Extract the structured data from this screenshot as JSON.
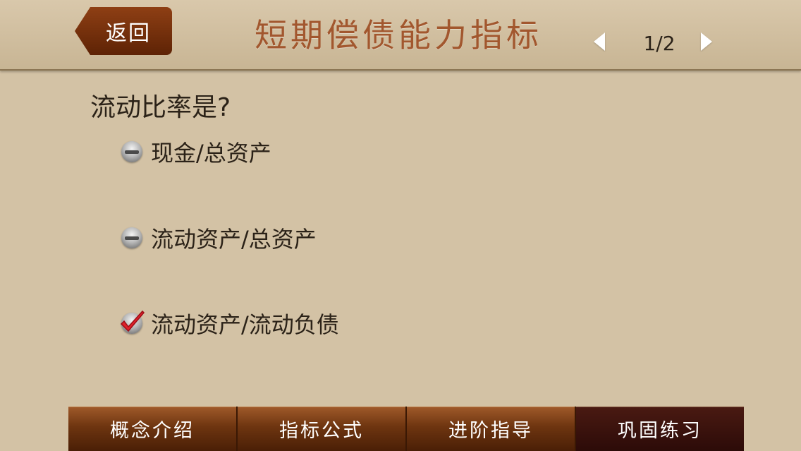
{
  "header": {
    "back_label": "返回",
    "title": "短期偿债能力指标",
    "page_indicator": "1/2"
  },
  "question": {
    "text": "流动比率是?",
    "options": [
      {
        "label": "现金/总资产",
        "selected": false
      },
      {
        "label": "流动资产/总资产",
        "selected": false
      },
      {
        "label": "流动资产/流动负债",
        "selected": true
      }
    ]
  },
  "tabs": [
    {
      "label": "概念介绍",
      "active": false
    },
    {
      "label": "指标公式",
      "active": false
    },
    {
      "label": "进阶指导",
      "active": false
    },
    {
      "label": "巩固练习",
      "active": true
    }
  ],
  "colors": {
    "background": "#d3c2a5",
    "title": "#a2572e",
    "back_button": "#7a3410",
    "tab": "#6e3510",
    "tab_active": "#2c0b08",
    "check": "#e0202a"
  },
  "icons": {
    "prev": "triangle-left-icon",
    "next": "triangle-right-icon",
    "unselected": "radio-icon",
    "selected": "checkmark-icon"
  }
}
